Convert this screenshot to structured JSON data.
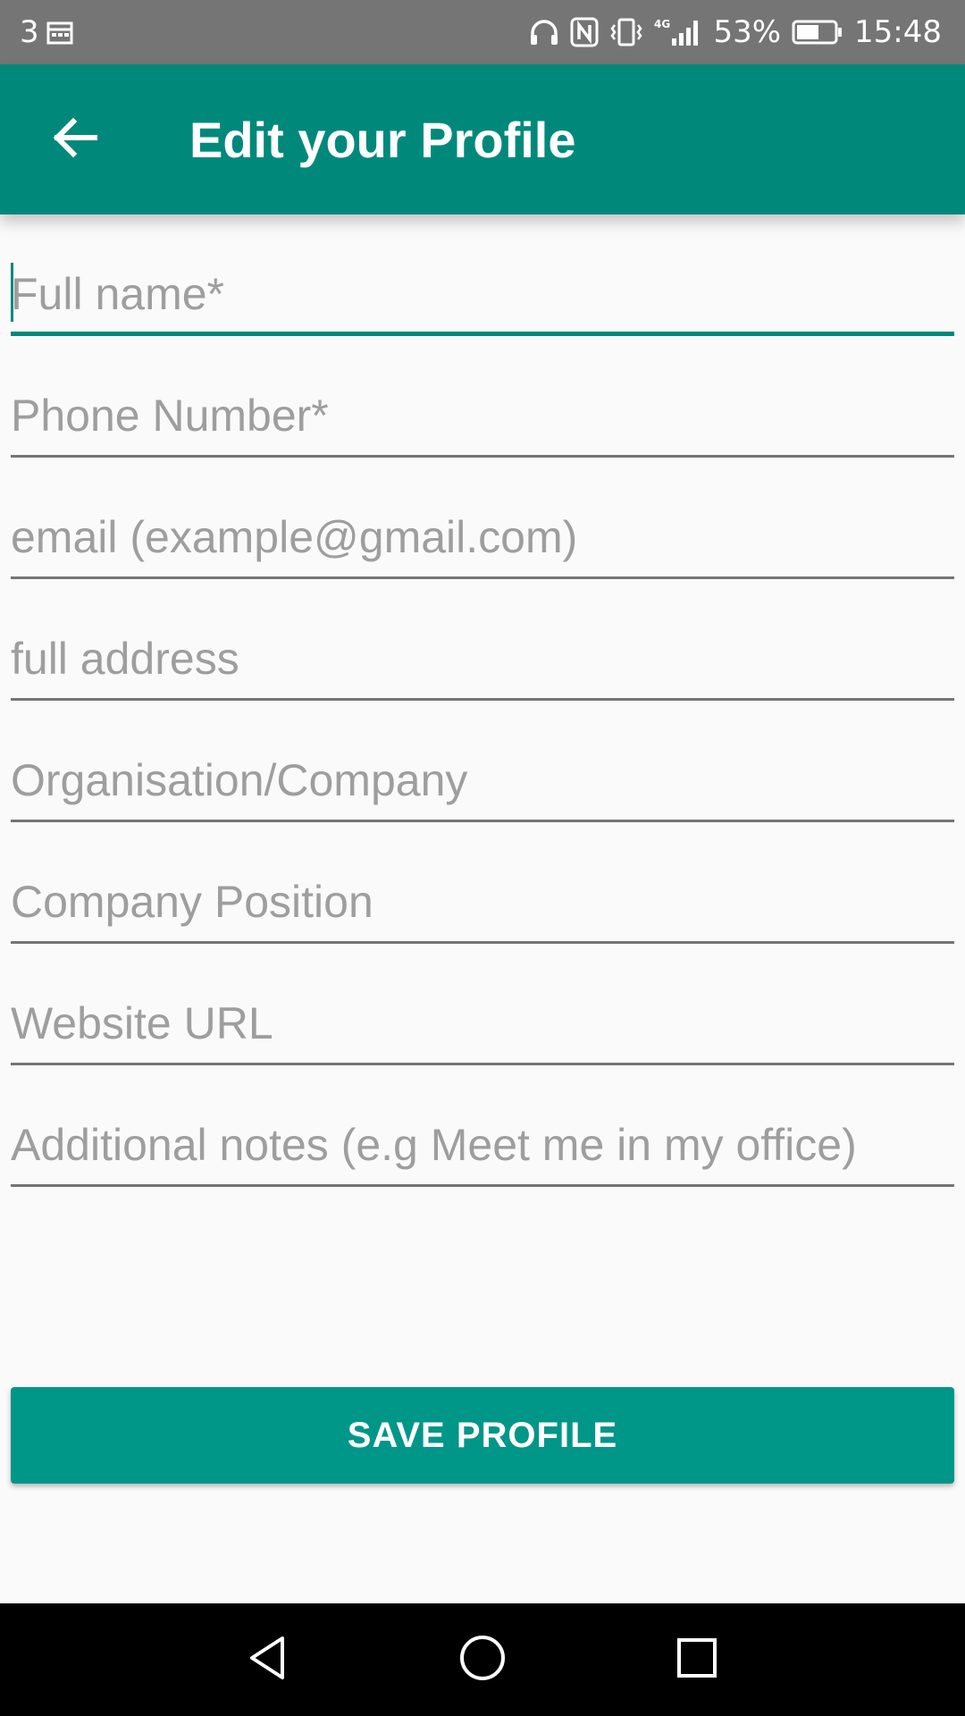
{
  "status_bar": {
    "notification_count": "3",
    "battery_percent": "53%",
    "time": "15:48",
    "network_label": "4G",
    "icons": [
      "calendar-icon",
      "headphones-icon",
      "nfc-icon",
      "vibrate-icon",
      "signal-icon",
      "battery-icon"
    ]
  },
  "app_bar": {
    "title": "Edit your Profile",
    "back_icon": "arrow-left-icon",
    "color": "#00897b"
  },
  "form": {
    "fields": [
      {
        "placeholder": "Full name*",
        "value": "",
        "focused": true
      },
      {
        "placeholder": "Phone Number*",
        "value": ""
      },
      {
        "placeholder": "email (example@gmail.com)",
        "value": ""
      },
      {
        "placeholder": "full address",
        "value": ""
      },
      {
        "placeholder": "Organisation/Company",
        "value": ""
      },
      {
        "placeholder": "Company Position",
        "value": ""
      },
      {
        "placeholder": "Website URL",
        "value": ""
      },
      {
        "placeholder": "Additional notes (e.g Meet me in my office)",
        "value": ""
      }
    ]
  },
  "save_button": {
    "label": "SAVE PROFILE",
    "color": "#009688"
  },
  "nav_bar": {
    "icons": [
      "back-triangle-icon",
      "home-circle-icon",
      "recents-square-icon"
    ]
  }
}
